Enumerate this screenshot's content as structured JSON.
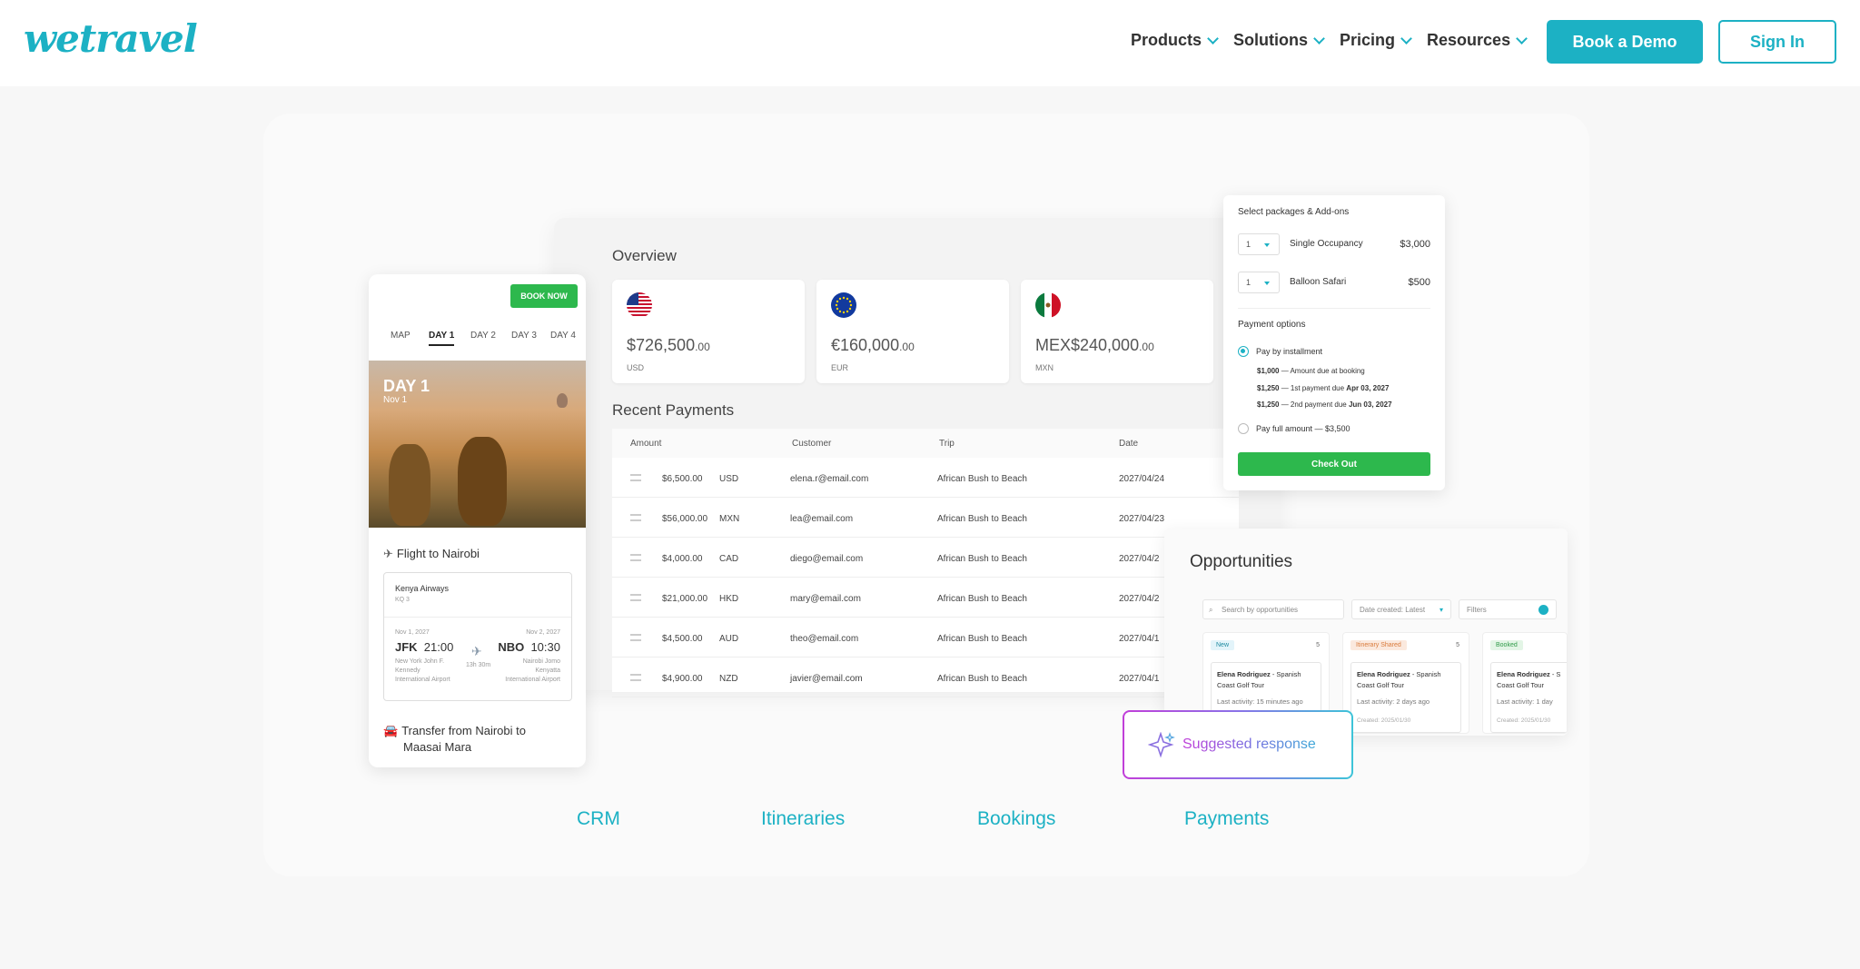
{
  "header": {
    "logo": "wetravel",
    "nav": [
      {
        "label": "Products"
      },
      {
        "label": "Solutions"
      },
      {
        "label": "Pricing"
      },
      {
        "label": "Resources"
      }
    ],
    "book_demo": "Book a Demo",
    "sign_in": "Sign In"
  },
  "dashboard": {
    "overview_title": "Overview",
    "currencies": [
      {
        "flag": "us-flag",
        "amount": "$726,500",
        "cents": ".00",
        "code": "USD"
      },
      {
        "flag": "eu-flag",
        "amount": "€160,000",
        "cents": ".00",
        "code": "EUR"
      },
      {
        "flag": "mx-flag",
        "amount": "MEX$240,000",
        "cents": ".00",
        "code": "MXN"
      }
    ],
    "recent_title": "Recent Payments",
    "columns": [
      "Amount",
      "Customer",
      "Trip",
      "Date"
    ],
    "rows": [
      {
        "amount": "$6,500.00",
        "cur": "USD",
        "customer": "elena.r@email.com",
        "trip": "African Bush to Beach",
        "date": "2027/04/24"
      },
      {
        "amount": "$56,000.00",
        "cur": "MXN",
        "customer": "lea@email.com",
        "trip": "African Bush to Beach",
        "date": "2027/04/23"
      },
      {
        "amount": "$4,000.00",
        "cur": "CAD",
        "customer": "diego@email.com",
        "trip": "African Bush to Beach",
        "date": "2027/04/2"
      },
      {
        "amount": "$21,000.00",
        "cur": "HKD",
        "customer": "mary@email.com",
        "trip": "African Bush to Beach",
        "date": "2027/04/2"
      },
      {
        "amount": "$4,500.00",
        "cur": "AUD",
        "customer": "theo@email.com",
        "trip": "African Bush to Beach",
        "date": "2027/04/1"
      },
      {
        "amount": "$4,900.00",
        "cur": "NZD",
        "customer": "javier@email.com",
        "trip": "African Bush to Beach",
        "date": "2027/04/1"
      }
    ]
  },
  "mobile": {
    "book_now": "BOOK NOW",
    "tabs": [
      "MAP",
      "DAY 1",
      "DAY 2",
      "DAY 3",
      "DAY 4"
    ],
    "photo_day": "DAY 1",
    "photo_date": "Nov 1",
    "flight_title": "Flight to Nairobi",
    "airline": "Kenya Airways",
    "flight_no": "KQ 3",
    "dep_date": "Nov 1, 2027",
    "dep_code": "JFK",
    "dep_time": "21:00",
    "dep_airport1": "New York John F.",
    "dep_airport2": "Kennedy",
    "dep_airport3": "International Airport",
    "duration": "13h 30m",
    "arr_date": "Nov 2, 2027",
    "arr_code": "NBO",
    "arr_time": "10:30",
    "arr_airport1": "Nairobi Jomo",
    "arr_airport2": "Kenyatta",
    "arr_airport3": "International Airport",
    "transfer_line1": "Transfer from Nairobi to",
    "transfer_line2": "Maasai Mara"
  },
  "checkout": {
    "title": "Select packages & Add-ons",
    "packages": [
      {
        "qty": "1",
        "name": "Single Occupancy",
        "price": "$3,000"
      },
      {
        "qty": "1",
        "name": "Balloon Safari",
        "price": "$500"
      }
    ],
    "payment_title": "Payment options",
    "installment_label": "Pay by installment",
    "installments": [
      {
        "amt": "$1,000",
        "text": " — Amount due at booking"
      },
      {
        "amt": "$1,250",
        "text": " — 1st payment due ",
        "due": "Apr 03, 2027"
      },
      {
        "amt": "$1,250",
        "text": " — 2nd payment due ",
        "due": "Jun 03, 2027"
      }
    ],
    "full_label": "Pay full amount — $3,500",
    "button": "Check Out"
  },
  "opportunities": {
    "title": "Opportunities",
    "search_placeholder": "Search by opportunities",
    "sort_label": "Date created: Latest",
    "filters_label": "Filters",
    "columns": [
      {
        "badge": "New",
        "count": "5",
        "name": "Elena Rodriguez",
        "trip1": " - Spanish",
        "trip2": "Coast Golf Tour",
        "activity": "Last activity: 15 minutes ago"
      },
      {
        "badge": "Itinerary Shared",
        "count": "5",
        "name": "Elena Rodriguez",
        "trip1": " - Spanish",
        "trip2": "Coast Golf Tour",
        "activity": "Last activity: 2 days ago",
        "created": "Created: 2025/01/30"
      },
      {
        "badge": "Booked",
        "count": "",
        "name": "Elena Rodriguez",
        "trip1": " - S",
        "trip2": "Coast Golf Tour",
        "activity": "Last activity: 1 day",
        "created": "Created: 2025/01/30"
      }
    ]
  },
  "suggested": "Suggested response",
  "bottom_tabs": [
    "CRM",
    "Itineraries",
    "Bookings",
    "Payments"
  ],
  "colors": {
    "brand": "#1cb1c4",
    "green": "#2db84d"
  }
}
